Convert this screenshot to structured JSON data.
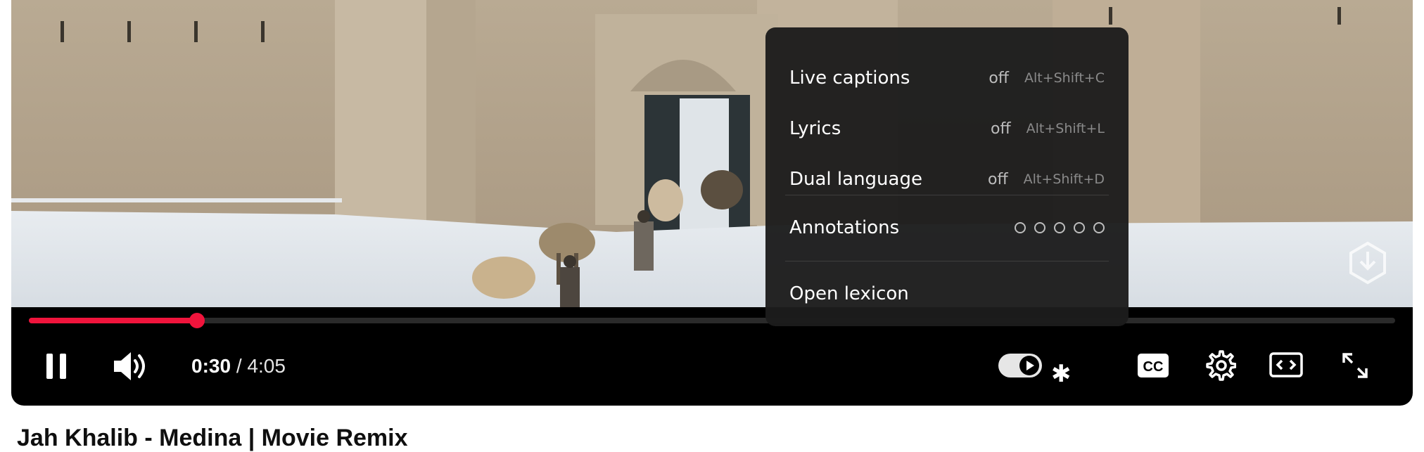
{
  "player": {
    "progress_fraction": 0.1232,
    "current_time": "0:30",
    "time_separator": "/",
    "duration": "4:05",
    "accent_color": "#f0143c"
  },
  "controls": {
    "pause_icon": "pause-icon",
    "volume_icon": "volume-high-icon",
    "autoplay_icon": "autoplay-toggle-icon",
    "autoplay_badge": "✱",
    "subtitles_icon": "cc-icon",
    "settings_icon": "gear-icon",
    "miniplayer_icon": "theater-icon",
    "fullscreen_icon": "fullscreen-icon"
  },
  "menu": {
    "items": [
      {
        "label": "Live captions",
        "state": "off",
        "shortcut": "Alt+Shift+C"
      },
      {
        "label": "Lyrics",
        "state": "off",
        "shortcut": "Alt+Shift+L"
      },
      {
        "label": "Dual language",
        "state": "off",
        "shortcut": "Alt+Shift+D"
      }
    ],
    "annotations": {
      "label": "Annotations",
      "level": 0,
      "max": 5
    },
    "open_lexicon": "Open lexicon"
  },
  "page": {
    "video_title_partial": "Jah Khalib - Medina | Movie Remix"
  }
}
